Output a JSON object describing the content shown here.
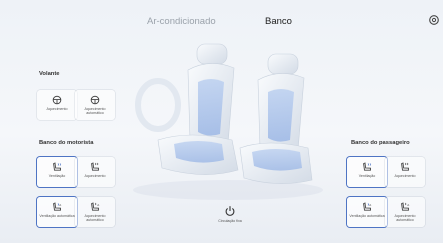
{
  "tabs": [
    {
      "label": "Ar-condicionado",
      "active": false
    },
    {
      "label": "Banco",
      "active": true
    }
  ],
  "corner_icon": "settings-icon",
  "volante": {
    "title": "Volante",
    "buttons": [
      {
        "label": "Aquecimento",
        "icon": "steering-wheel-heat-icon"
      },
      {
        "label": "Aquecimento automático",
        "icon": "steering-wheel-auto-icon"
      }
    ]
  },
  "driver": {
    "title": "Banco do motorista",
    "buttons": [
      {
        "label": "Ventilação",
        "icon": "seat-ventilation-icon",
        "active": true
      },
      {
        "label": "Aquecimento",
        "icon": "seat-heat-icon",
        "active": false
      },
      {
        "label": "Ventilação automática",
        "icon": "seat-auto-ventilation-icon",
        "active": true
      },
      {
        "label": "Aquecimento automático",
        "icon": "seat-auto-heat-icon",
        "active": false
      }
    ]
  },
  "passenger": {
    "title": "Banco do passageiro",
    "buttons": [
      {
        "label": "Ventilação",
        "icon": "seat-ventilation-icon",
        "active": true
      },
      {
        "label": "Aquecimento",
        "icon": "seat-heat-icon",
        "active": false
      },
      {
        "label": "Ventilação automática",
        "icon": "seat-auto-ventilation-icon",
        "active": true
      },
      {
        "label": "Aquecimento automático",
        "icon": "seat-auto-heat-icon",
        "active": false
      }
    ]
  },
  "power": {
    "label": "Circulação fixa",
    "icon": "power-icon"
  },
  "colors": {
    "accent": "#4e74c4",
    "muted": "#9ba2ab"
  }
}
